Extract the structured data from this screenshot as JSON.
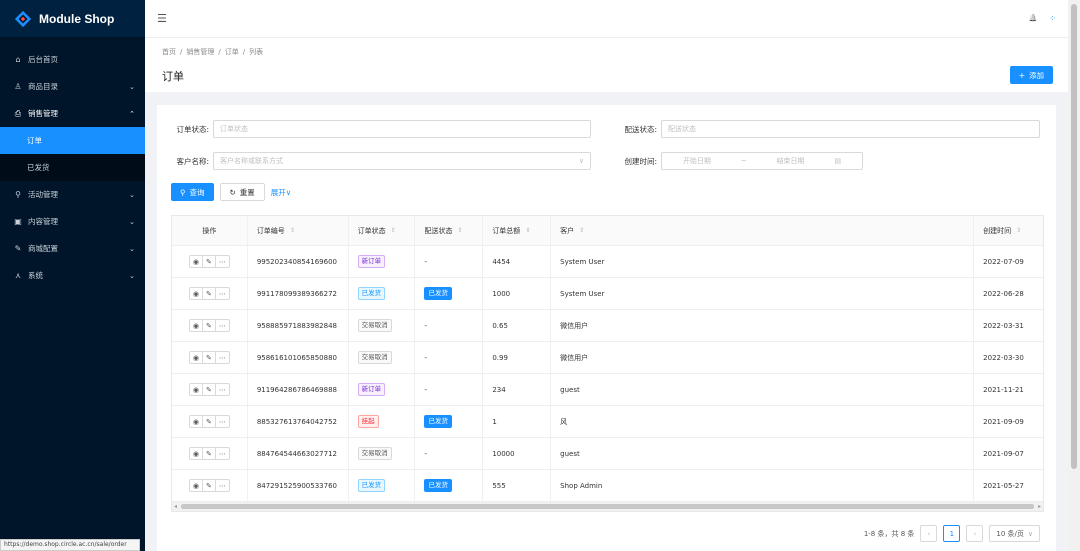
{
  "app": {
    "name": "Module Shop"
  },
  "sidebar": {
    "items": [
      {
        "label": "后台首页",
        "icon": "home-icon",
        "glyph": "⌂"
      },
      {
        "label": "商品目录",
        "icon": "catalog-icon",
        "glyph": "♙",
        "chevron": "⌄"
      },
      {
        "label": "销售管理",
        "icon": "shop-icon",
        "glyph": "⎙",
        "chevron": "⌃"
      },
      {
        "label": "活动管理",
        "icon": "location-icon",
        "glyph": "⚲",
        "chevron": "⌄"
      },
      {
        "label": "内容管理",
        "icon": "content-icon",
        "glyph": "▣",
        "chevron": "⌄"
      },
      {
        "label": "商城配置",
        "icon": "wrench-icon",
        "glyph": "✎",
        "chevron": "⌄"
      },
      {
        "label": "系统",
        "icon": "cluster-icon",
        "glyph": "⋏",
        "chevron": "⌄"
      }
    ],
    "sales_sub": [
      {
        "label": "订单"
      },
      {
        "label": "已发货"
      }
    ]
  },
  "header": {
    "collapse_glyph": "☰",
    "bell_glyph": "🔔",
    "menu_glyph": "⁘"
  },
  "page": {
    "breadcrumb": [
      "首页",
      "销售管理",
      "订单",
      "列表"
    ],
    "breadcrumb_sep": "/",
    "title": "订单",
    "add_label": "添加",
    "add_glyph": "+"
  },
  "filters": {
    "order_status_label": "订单状态:",
    "order_status_placeholder": "订单状态",
    "ship_status_label": "配送状态:",
    "ship_status_placeholder": "配送状态",
    "customer_label": "客户名称:",
    "customer_placeholder": "客户名称或联系方式",
    "created_label": "创建时间:",
    "start_placeholder": "开始日期",
    "range_sep": "~",
    "end_placeholder": "结束日期",
    "query_label": "查询",
    "reset_label": "重置",
    "expand_label": "展开",
    "expand_glyph": "∨",
    "search_glyph": "⚲",
    "reset_glyph": "↻",
    "calendar_glyph": "▤",
    "chevron_glyph": "∨"
  },
  "table": {
    "headers": [
      "操作",
      "订单编号",
      "订单状态",
      "配送状态",
      "订单总额",
      "客户",
      "创建时间"
    ],
    "sort_glyph": "⇕",
    "op_glyphs": [
      "◉",
      "✎",
      "⋯"
    ],
    "rows": [
      {
        "id": "995202340854169600",
        "status": "新订单",
        "status_type": "new",
        "ship": "-",
        "ship_tag": false,
        "total": "4454",
        "customer": "System User",
        "created": "2022-07-09"
      },
      {
        "id": "991178099389366272",
        "status": "已发货",
        "status_type": "shipped",
        "ship": "已发货",
        "ship_tag": true,
        "total": "1000",
        "customer": "System User",
        "created": "2022-06-28"
      },
      {
        "id": "958885971883982848",
        "status": "交易取消",
        "status_type": "cancel",
        "ship": "-",
        "ship_tag": false,
        "total": "0.65",
        "customer": "微信用户",
        "created": "2022-03-31"
      },
      {
        "id": "958616101065850880",
        "status": "交易取消",
        "status_type": "cancel",
        "ship": "-",
        "ship_tag": false,
        "total": "0.99",
        "customer": "微信用户",
        "created": "2022-03-30"
      },
      {
        "id": "911964286786469888",
        "status": "新订单",
        "status_type": "new",
        "ship": "-",
        "ship_tag": false,
        "total": "234",
        "customer": "guest",
        "created": "2021-11-21"
      },
      {
        "id": "885327613764042752",
        "status": "挂起",
        "status_type": "hold",
        "ship": "已发货",
        "ship_tag": true,
        "total": "1",
        "customer": "风",
        "created": "2021-09-09"
      },
      {
        "id": "884764544663027712",
        "status": "交易取消",
        "status_type": "cancel",
        "ship": "-",
        "ship_tag": false,
        "total": "10000",
        "customer": "guest",
        "created": "2021-09-07"
      },
      {
        "id": "847291525900533760",
        "status": "已发货",
        "status_type": "shipped",
        "ship": "已发货",
        "ship_tag": true,
        "total": "555",
        "customer": "Shop Admin",
        "created": "2021-05-27"
      }
    ],
    "scroll_left": "◂",
    "scroll_right": "▸"
  },
  "pagination": {
    "summary": "1-8 条，共 8 条",
    "prev": "‹",
    "current": "1",
    "next": "›",
    "page_size": "10 条/页",
    "page_size_chevron": "∨"
  },
  "status_url": "https://demo.shop.circle.ac.cn/sale/order",
  "colors": {
    "primary": "#1890ff",
    "sidebar_bg": "#001529"
  }
}
